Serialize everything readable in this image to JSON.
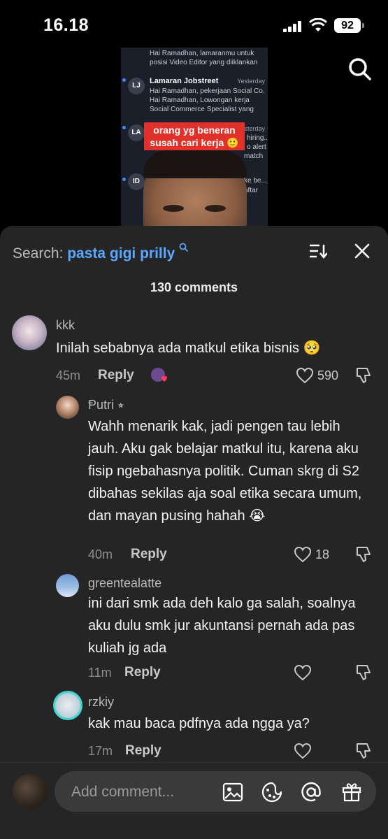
{
  "status": {
    "time": "16.18",
    "battery": "92"
  },
  "video": {
    "rows": [
      {
        "text": "Hai Ramadhan, lamaranmu untuk"
      },
      {
        "text": "posisi Video Editor yang diiklankan"
      },
      {
        "avatar": "LJ",
        "title": "Lamaran Jobstreet",
        "date": "Yesterday",
        "line1": "Hai Ramadhan, pekerjaan Social Co...",
        "line2": "Hai Ramadhan, Lowongan kerja",
        "line3": "Social Commerce Specialist yang"
      },
      {
        "avatar": "LA",
        "date": "sterday",
        "line1": "hiring...",
        "line2": "o alert",
        "line3": "match"
      },
      {
        "avatar": "ID",
        "line1": "ke be...",
        "line2": "aftar"
      }
    ],
    "caption": "orang yg beneran susah cari kerja 🙂"
  },
  "sheet": {
    "search_label": "Search:",
    "search_query": "pasta gigi prilly",
    "count": "130 comments"
  },
  "comments": [
    {
      "user": "kkk",
      "text": "Inilah sebabnya ada matkul etika bisnis 🥺",
      "time": "45m",
      "reply": "Reply",
      "likes": "590"
    },
    {
      "user": "Ᵽutri ⭒",
      "text": "Wahh menarik kak, jadi pengen tau lebih jauh. Aku gak belajar matkul itu, karena aku fisip ngebahasnya politik. Cuman skrg di S2 dibahas sekilas aja soal etika secara umum, dan mayan pusing hahah 😭",
      "time": "40m",
      "reply": "Reply",
      "likes": "18"
    },
    {
      "user": "greentealatte",
      "text": "ini dari smk ada deh kalo ga salah, soalnya aku dulu smk jur akuntansi pernah ada pas kuliah jg ada",
      "time": "11m",
      "reply": "Reply",
      "likes": ""
    },
    {
      "user": "rzkiy",
      "text": "kak mau baca pdfnya ada ngga ya?",
      "time": "17m",
      "reply": "Reply",
      "likes": ""
    }
  ],
  "composer": {
    "placeholder": "Add comment..."
  }
}
